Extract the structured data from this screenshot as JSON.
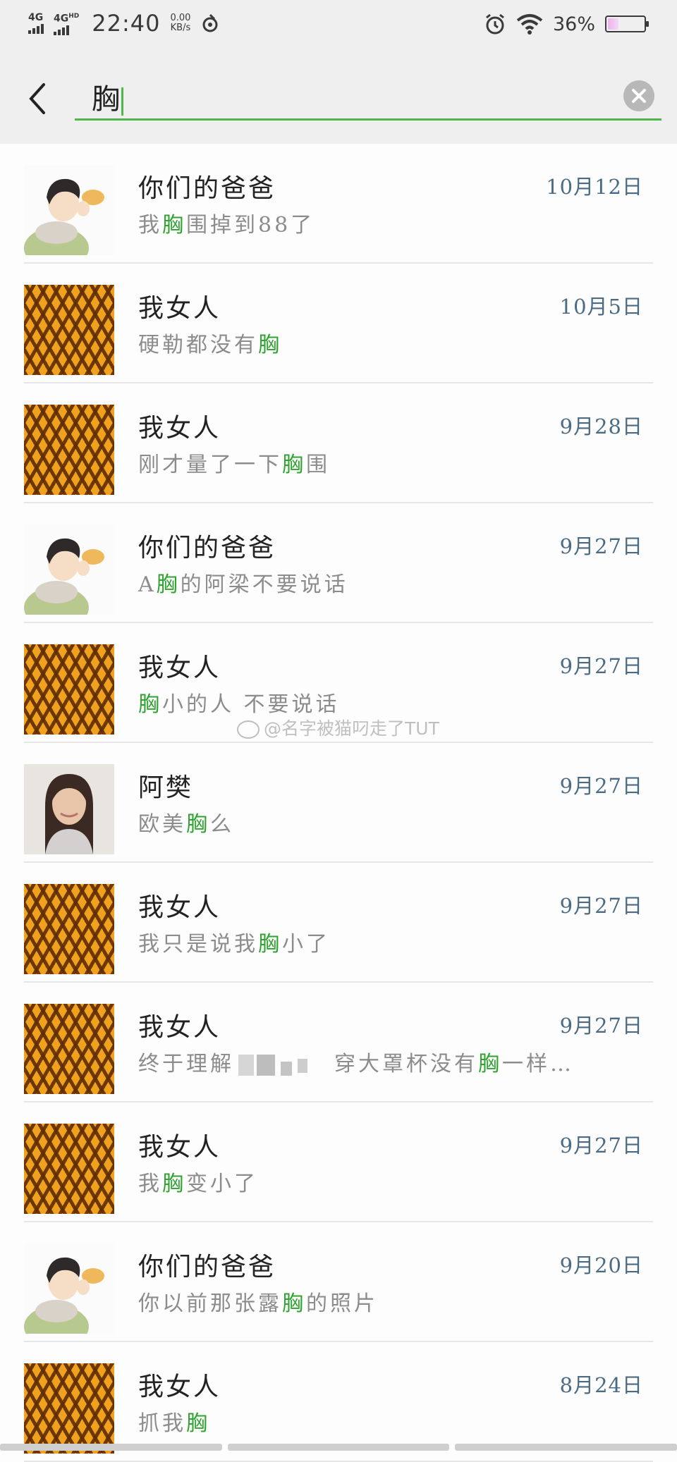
{
  "status_bar": {
    "signal1": "4G",
    "signal2": "4G",
    "signal2_sup": "HD",
    "time": "22:40",
    "speed_value": "0.00",
    "speed_unit": "KB/s",
    "battery_percent": "36%",
    "battery_level": 0.36
  },
  "search": {
    "query": "胸"
  },
  "results": [
    {
      "name": "你们的爸爸",
      "date": "10月12日",
      "avatar": "boy",
      "pre": "我",
      "hl": "胸",
      "post": "围掉到88了"
    },
    {
      "name": "我女人",
      "date": "10月5日",
      "avatar": "pattern",
      "pre": "硬勒都没有",
      "hl": "胸",
      "post": ""
    },
    {
      "name": "我女人",
      "date": "9月28日",
      "avatar": "pattern",
      "pre": "刚才量了一下",
      "hl": "胸",
      "post": "围"
    },
    {
      "name": "你们的爸爸",
      "date": "9月27日",
      "avatar": "boy",
      "pre": "A",
      "hl": "胸",
      "post": "的阿梁不要说话"
    },
    {
      "name": "我女人",
      "date": "9月27日",
      "avatar": "pattern",
      "pre": "",
      "hl": "胸",
      "post": "小的人 不要说话"
    },
    {
      "name": "阿樊",
      "date": "9月27日",
      "avatar": "girl",
      "pre": "欧美",
      "hl": "胸",
      "post": "么"
    },
    {
      "name": "我女人",
      "date": "9月27日",
      "avatar": "pattern",
      "pre": "我只是说我",
      "hl": "胸",
      "post": "小了"
    },
    {
      "name": "我女人",
      "date": "9月27日",
      "avatar": "pattern",
      "pre": "终于理解",
      "hl": "胸",
      "post": "一样…",
      "mid": "穿大罩杯没有",
      "redacted": true
    },
    {
      "name": "我女人",
      "date": "9月27日",
      "avatar": "pattern",
      "pre": "我",
      "hl": "胸",
      "post": "变小了"
    },
    {
      "name": "你们的爸爸",
      "date": "9月20日",
      "avatar": "boy",
      "pre": "你以前那张露",
      "hl": "胸",
      "post": "的照片"
    },
    {
      "name": "我女人",
      "date": "8月24日",
      "avatar": "pattern",
      "pre": "抓我",
      "hl": "胸",
      "post": ""
    }
  ],
  "watermark": "@名字被猫叼走了TUT",
  "colors": {
    "accent": "#4fb54f",
    "highlight": "#2fa32f",
    "date": "#4b6b85",
    "background": "#fdfdfd",
    "header": "#efefef"
  }
}
